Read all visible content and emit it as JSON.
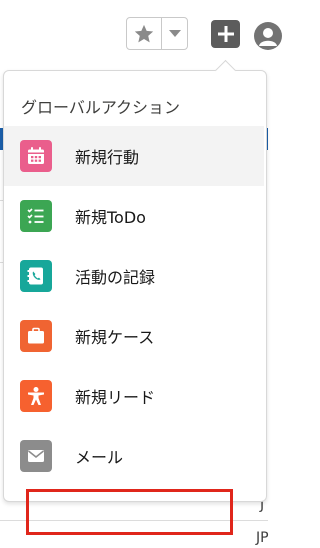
{
  "header": {
    "favorites_icon": "star-icon",
    "favorites_menu_icon": "chevron-down-icon",
    "global_actions_icon": "plus-icon"
  },
  "popover": {
    "title": "グローバルアクション",
    "items": [
      {
        "label": "新規行動",
        "icon": "calendar-icon",
        "color": "#ea5e8c"
      },
      {
        "label": "新規ToDo",
        "icon": "task-list-icon",
        "color": "#3ca653"
      },
      {
        "label": "活動の記録",
        "icon": "phone-icon",
        "color": "#17a79a"
      },
      {
        "label": "新規ケース",
        "icon": "briefcase-icon",
        "color": "#f06432"
      },
      {
        "label": "新規リード",
        "icon": "person-icon",
        "color": "#f6612f"
      },
      {
        "label": "メール",
        "icon": "email-icon",
        "color": "#8c8c8c"
      }
    ]
  },
  "background": {
    "fragment_1": "l",
    "fragment_2": "J",
    "fragment_3": "JP"
  },
  "colors": {
    "highlight_border": "#e0261b",
    "header_blue": "#1b5faa"
  }
}
